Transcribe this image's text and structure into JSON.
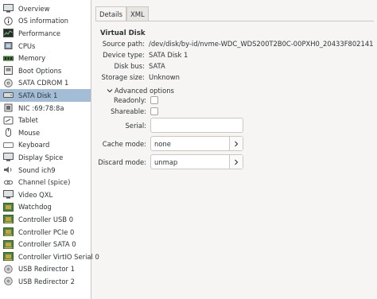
{
  "sidebar": {
    "items": [
      {
        "label": "Overview",
        "icon": "monitor-icon"
      },
      {
        "label": "OS information",
        "icon": "info-icon"
      },
      {
        "label": "Performance",
        "icon": "performance-icon"
      },
      {
        "label": "CPUs",
        "icon": "cpu-icon"
      },
      {
        "label": "Memory",
        "icon": "memory-icon"
      },
      {
        "label": "Boot Options",
        "icon": "boot-icon"
      },
      {
        "label": "SATA CDROM 1",
        "icon": "cdrom-icon"
      },
      {
        "label": "SATA Disk 1",
        "icon": "disk-icon"
      },
      {
        "label": "NIC :69:78:8a",
        "icon": "network-icon"
      },
      {
        "label": "Tablet",
        "icon": "tablet-icon"
      },
      {
        "label": "Mouse",
        "icon": "mouse-icon"
      },
      {
        "label": "Keyboard",
        "icon": "keyboard-icon"
      },
      {
        "label": "Display Spice",
        "icon": "display-icon"
      },
      {
        "label": "Sound ich9",
        "icon": "sound-icon"
      },
      {
        "label": "Channel (spice)",
        "icon": "channel-icon"
      },
      {
        "label": "Video QXL",
        "icon": "video-icon"
      },
      {
        "label": "Watchdog",
        "icon": "watchdog-icon"
      },
      {
        "label": "Controller USB 0",
        "icon": "controller-icon"
      },
      {
        "label": "Controller PCIe 0",
        "icon": "controller-icon"
      },
      {
        "label": "Controller SATA 0",
        "icon": "controller-icon"
      },
      {
        "label": "Controller VirtIO Serial 0",
        "icon": "controller-icon"
      },
      {
        "label": "USB Redirector 1",
        "icon": "usb-redirector-icon"
      },
      {
        "label": "USB Redirector 2",
        "icon": "usb-redirector-icon"
      }
    ],
    "selected_index": 7,
    "selected_color": "#a4bdd6"
  },
  "tabs": [
    {
      "label": "Details",
      "active": true
    },
    {
      "label": "XML",
      "active": false
    }
  ],
  "details": {
    "heading": "Virtual Disk",
    "source_path_label": "Source path:",
    "source_path_value": "/dev/disk/by-id/nvme-WDC_WDS200T2B0C-00PXH0_20433F802141",
    "device_type_label": "Device type:",
    "device_type_value": "SATA Disk 1",
    "disk_bus_label": "Disk bus:",
    "disk_bus_value": "SATA",
    "storage_size_label": "Storage size:",
    "storage_size_value": "Unknown",
    "advanced_label": "Advanced options",
    "readonly_label": "Readonly:",
    "shareable_label": "Shareable:",
    "serial_label": "Serial:",
    "serial_value": "",
    "cache_mode_label": "Cache mode:",
    "cache_mode_value": "none",
    "discard_mode_label": "Discard mode:",
    "discard_mode_value": "unmap"
  }
}
